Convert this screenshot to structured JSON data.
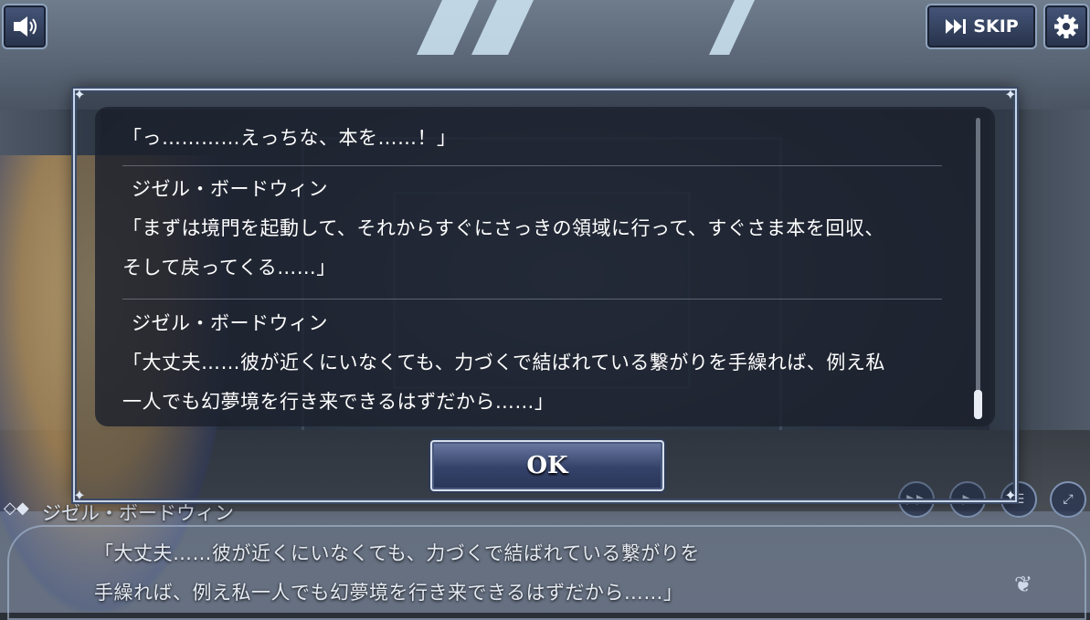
{
  "top_buttons": {
    "volume_icon": "speaker-icon",
    "skip_label": "SKIP",
    "skip_icon": "fast-forward-icon",
    "settings_icon": "gear-icon"
  },
  "backlog": {
    "entries": [
      {
        "speaker": "",
        "text_lines": [
          "「っ…………えっちな、本を……！」"
        ]
      },
      {
        "speaker": "ジゼル・ボードウィン",
        "text_lines": [
          "「まずは境門を起動して、それからすぐにさっきの領域に行って、すぐさま本を回収、",
          "そして戻ってくる……」"
        ]
      },
      {
        "speaker": "ジゼル・ボードウィン",
        "text_lines": [
          "「大丈夫……彼が近くにいなくても、力づくで結ばれている繋がりを手繰れば、例え私",
          "一人でも幻夢境を行き来できるはずだから……」"
        ]
      }
    ],
    "ok_label": "OK"
  },
  "message_window": {
    "speaker": "ジゼル・ボードウィン",
    "lines": [
      "「大丈夫……彼が近くにいなくても、力づくで結ばれている繋がりを",
      "手繰れば、例え私一人でも幻夢境を行き来できるはずだから……」"
    ]
  },
  "controls": [
    "auto-icon",
    "play-icon",
    "log-icon",
    "fullscreen-icon"
  ]
}
